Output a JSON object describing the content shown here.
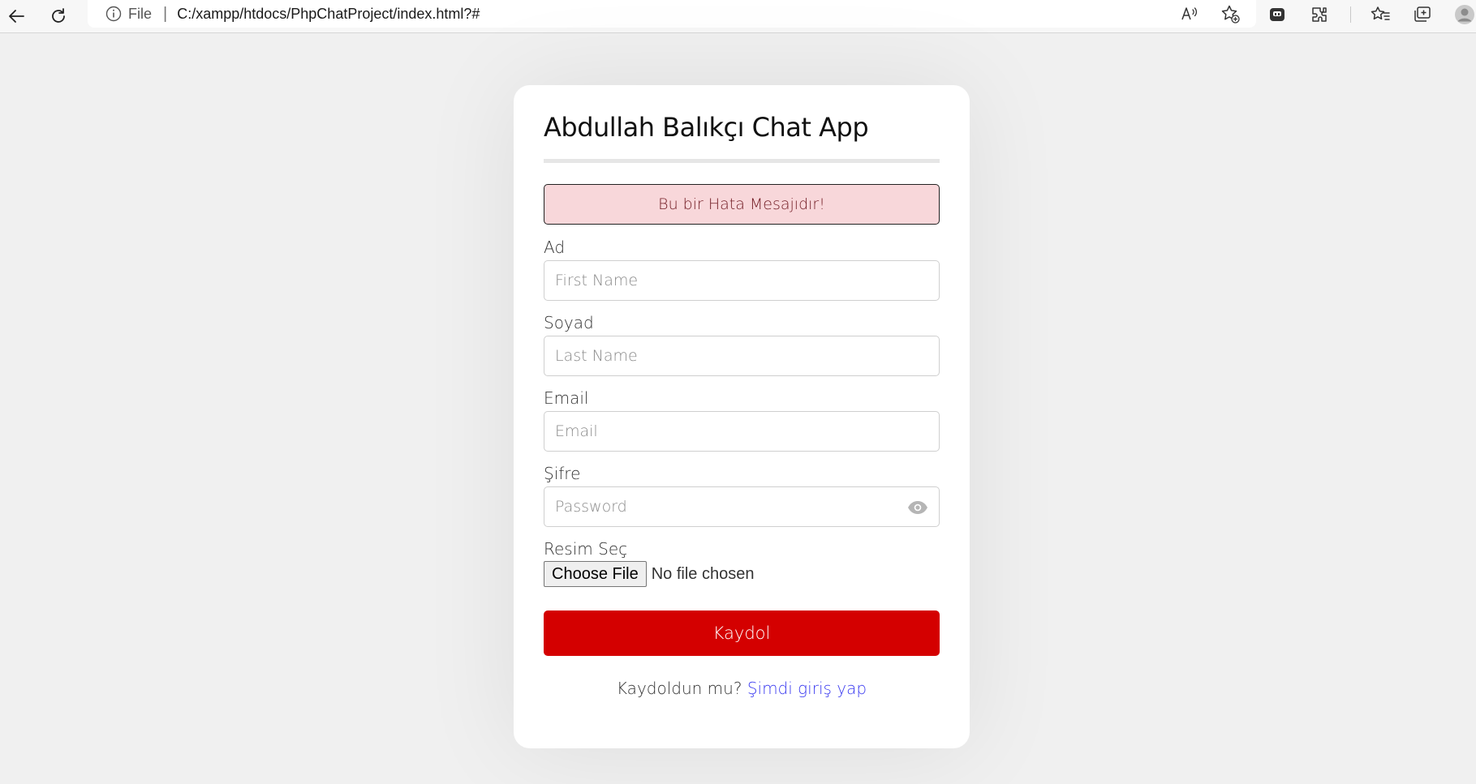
{
  "browser": {
    "address_scheme": "File",
    "address_url": "C:/xampp/htdocs/PhpChatProject/index.html?#",
    "icons": [
      "back-icon",
      "refresh-icon",
      "info-icon",
      "read-aloud-icon",
      "add-favorite-icon",
      "copilot-icon",
      "extensions-icon",
      "favorites-icon",
      "collections-icon",
      "profile-icon"
    ]
  },
  "card": {
    "title": "Abdullah Balıkçı Chat App",
    "error_message": "Bu bir Hata Mesajıdır!",
    "fields": {
      "first_name_label": "Ad",
      "first_name_placeholder": "First Name",
      "last_name_label": "Soyad",
      "last_name_placeholder": "Last Name",
      "email_label": "Email",
      "email_placeholder": "Email",
      "password_label": "Şifre",
      "password_placeholder": "Password",
      "image_label": "Resim Seç",
      "file_button": "Choose File",
      "file_status": "No file chosen"
    },
    "submit_label": "Kaydol",
    "footer_text": "Kaydoldun mu?",
    "footer_link": "Şimdi giriş yap"
  },
  "colors": {
    "accent_button": "#d40000",
    "error_bg": "#f8d7da",
    "link": "#3b3bf0",
    "page_bg": "#f0f0f0"
  }
}
